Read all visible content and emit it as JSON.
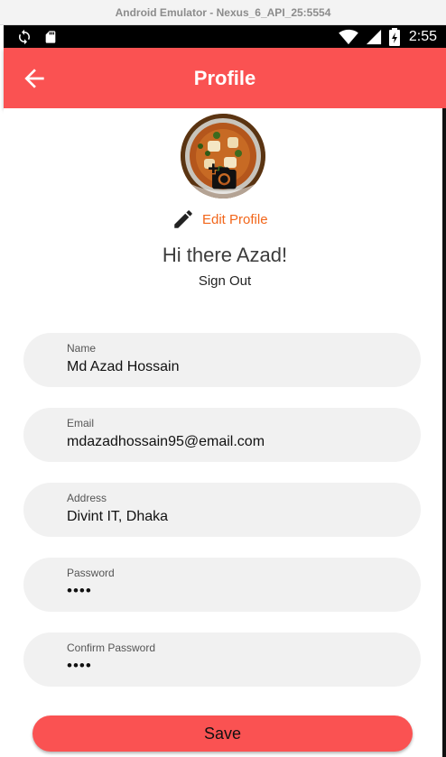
{
  "emulator": {
    "title": "Android Emulator - Nexus_6_API_25:5554"
  },
  "status_bar": {
    "time": "2:55",
    "icons": [
      "sync-icon",
      "sd-card-icon",
      "wifi-icon",
      "signal-icon",
      "battery-icon"
    ]
  },
  "app_bar": {
    "title": "Profile",
    "back_icon": "arrow-back-icon",
    "color": "#fa5252"
  },
  "profile": {
    "edit_label": "Edit Profile",
    "edit_icon": "pencil-icon",
    "camera_icon": "camera-icon",
    "greeting": "Hi there Azad!",
    "sign_out": "Sign Out"
  },
  "form": {
    "fields": [
      {
        "label": "Name",
        "value": "Md Azad Hossain"
      },
      {
        "label": "Email",
        "value": "mdazadhossain95@email.com"
      },
      {
        "label": "Address",
        "value": "Divint IT, Dhaka"
      },
      {
        "label": "Password",
        "value": "••••"
      },
      {
        "label": "Confirm Password",
        "value": "••••"
      }
    ],
    "save_label": "Save"
  },
  "colors": {
    "accent": "#fa5252",
    "edit_text": "#f2661a",
    "field_bg": "#f1f1f1"
  }
}
